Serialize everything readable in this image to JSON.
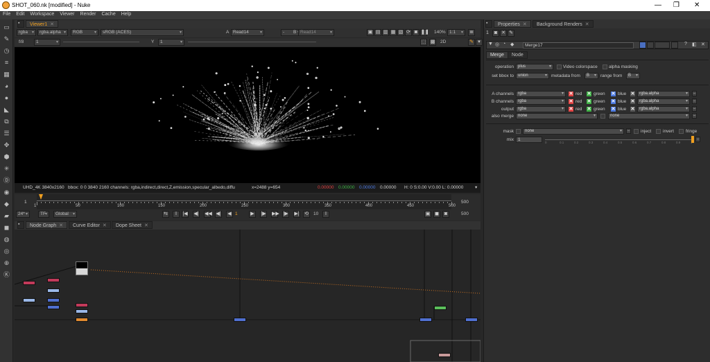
{
  "window": {
    "title": "SHOT_060.nk [modified] - Nuke",
    "controls": [
      "—",
      "❐",
      "✕"
    ]
  },
  "menu": [
    "File",
    "Edit",
    "Workspace",
    "Viewer",
    "Render",
    "Cache",
    "Help"
  ],
  "viewer": {
    "tab": "Viewer1",
    "channels": "rgba",
    "alpha": "rgba.alpha",
    "display_channel": "RGB",
    "colorspace": "sRGB (ACES)",
    "input_a_label": "A",
    "input_a": "Read14",
    "wipe": "-",
    "input_b_label": "B",
    "input_b": "Read14",
    "zoom": "140%",
    "proxy": "1:1",
    "view_mode": "2D",
    "frame_counter": "f/8",
    "gain_value": "1",
    "gamma_label": "Y",
    "gamma_value": "1",
    "format": "UHD_4K 3840x2160",
    "info": "bbox: 0 0 3840 2160 channels: rgba,indirect,direct,Z,emission,specular_albedo,diffu",
    "coords": "x=2488 y=654",
    "pixel_r": "0.00000",
    "pixel_g": "0.00000",
    "pixel_b": "0.00000",
    "pixel_a": "0.00000",
    "hsvl": "H:  0 S:0.00 V:0.00   L: 0.00000"
  },
  "timeline": {
    "start": "1",
    "end": "500",
    "end_right": "500",
    "labels": [
      "1",
      "50",
      "100",
      "150",
      "200",
      "250",
      "300",
      "350",
      "400",
      "450",
      "500"
    ],
    "fps": "24*",
    "tf": "TF",
    "range": "Global",
    "current_frame": "1",
    "increment": "10",
    "end_field": "500"
  },
  "bottom_tabs": [
    "Node Graph",
    "Curve Editor",
    "Dope Sheet"
  ],
  "properties": {
    "tabs": [
      "Properties",
      "Background Renders"
    ],
    "node_name": "Merge17",
    "subtabs": [
      "Merge",
      "Node"
    ],
    "operation_label": "operation",
    "operation": "plus",
    "video_colorspace": "Video colorspace",
    "alpha_masking": "alpha masking",
    "set_bbox_label": "set bbox to",
    "set_bbox": "union",
    "metadata_from_label": "metadata from",
    "metadata_from": "B",
    "range_from_label": "range from",
    "range_from": "B",
    "rows": [
      {
        "label": "A channels",
        "value": "rgba",
        "alpha": "rgba.alpha"
      },
      {
        "label": "B channels",
        "value": "rgba",
        "alpha": "rgba.alpha"
      },
      {
        "label": "output",
        "value": "rgba",
        "alpha": "rgba.alpha"
      }
    ],
    "ch_red": "red",
    "ch_green": "green",
    "ch_blue": "blue",
    "also_merge_label": "also merge",
    "also_merge": "none",
    "also_merge_2": "none",
    "mask_label": "mask",
    "mask": "none",
    "inject": "inject",
    "invert": "invert",
    "fringe": "fringe",
    "mix_label": "mix",
    "mix": "1",
    "slider_ticks": [
      "0",
      "0.1",
      "0.2",
      "0.3",
      "0.4",
      "0.5",
      "0.6",
      "0.7",
      "0.8",
      "0.9",
      "1"
    ]
  },
  "colors": {
    "accent": "#f0a020",
    "red": "#e04040",
    "green": "#3cb043",
    "blue": "#4a78e0"
  }
}
